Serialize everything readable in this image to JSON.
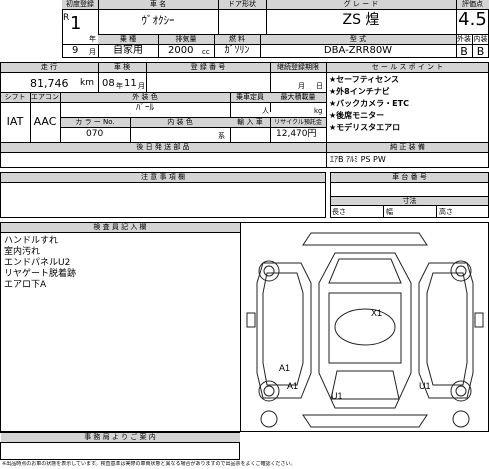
{
  "header": {
    "first_reg_label": "初度登録",
    "car_name_label": "車 名",
    "door_label": "ドア形状",
    "grade_label": "グ レ ー ド",
    "score_label": "評価点",
    "era_prefix": "R",
    "era_year": "1",
    "year_unit": "年",
    "car_name": "ｳﾞｵｸｼｰ",
    "grade": "ZS 煌",
    "score": "4.5",
    "month": "9",
    "month_unit": "月",
    "usage_label": "乗 種",
    "displacement_label": "排気量",
    "fuel_label": "燃 料",
    "model_label": "型 式",
    "ext_label": "外装",
    "int_label": "内装",
    "usage": "自家用",
    "displacement": "2000",
    "cc": "cc",
    "fuel": "ｶﾞｿﾘﾝ",
    "model": "DBA-ZRR80W",
    "ext_grade": "B",
    "int_grade": "B"
  },
  "mid": {
    "mileage_label": "走 行",
    "inspection_label": "車 検",
    "reg_no_label": "登 録 番 号",
    "expiry_label": "継続登録期限",
    "sales_label": "セ ー ル ス ポ イ ン ト",
    "mileage": "81,746",
    "km": "km",
    "insp_year": "08",
    "insp_year_unit": "年",
    "insp_month": "11",
    "insp_month_unit": "月",
    "expiry_month": "月",
    "expiry_day": "日",
    "shift_label": "シフト",
    "ac_label": "エアコン",
    "ext_color_label": "外 装 色",
    "capacity_label": "乗車定員",
    "load_label": "最大積載量",
    "shift": "IAT",
    "ac": "AAC",
    "ext_color": "ﾊﾟｰﾙ",
    "capacity_unit": "人",
    "load_unit": "kg",
    "color_no_label": "カ ラ ー No.",
    "int_color_label": "内 装 色",
    "import_label": "輸 入 車",
    "recycle_label": "リサイクル預託金",
    "color_no": "070",
    "int_color_unit": "系",
    "recycle_amount": "12,470円",
    "retrofit_label": "後 日 発 送 部 品",
    "sales_points": [
      "★セーフティセンス",
      "★外8インチナビ",
      "★バックカメラ・ETC",
      "★後席モニター",
      "★モデリスタエアロ"
    ],
    "equip_label": "純 正 装 備",
    "equip": "ｴｱB ｱﾙﾐ PS PW"
  },
  "notes": {
    "notes_label": "注 意 事 項 欄",
    "plate_label": "車 台 番 号",
    "dims_label": "寸法",
    "length_label": "長さ",
    "width_label": "幅",
    "height_label": "高さ",
    "inspector_label": "検 査 員 記 入 欄",
    "inspector_lines": [
      "ハンドルすれ",
      "室内汚れ",
      "エンドパネルU2",
      "リヤゲート脱着跡",
      "エアロ下A"
    ],
    "office_label": "事 務 局 よ り ご 案 内",
    "footer": "※出品時点のお車の状態を表示しています。検査基準は実際の車両状態と異なる場合がありますので出品票をよくご確認ください。"
  },
  "diagram": {
    "marks": [
      "X1",
      "A1",
      "A1",
      "U1",
      "U1"
    ]
  }
}
